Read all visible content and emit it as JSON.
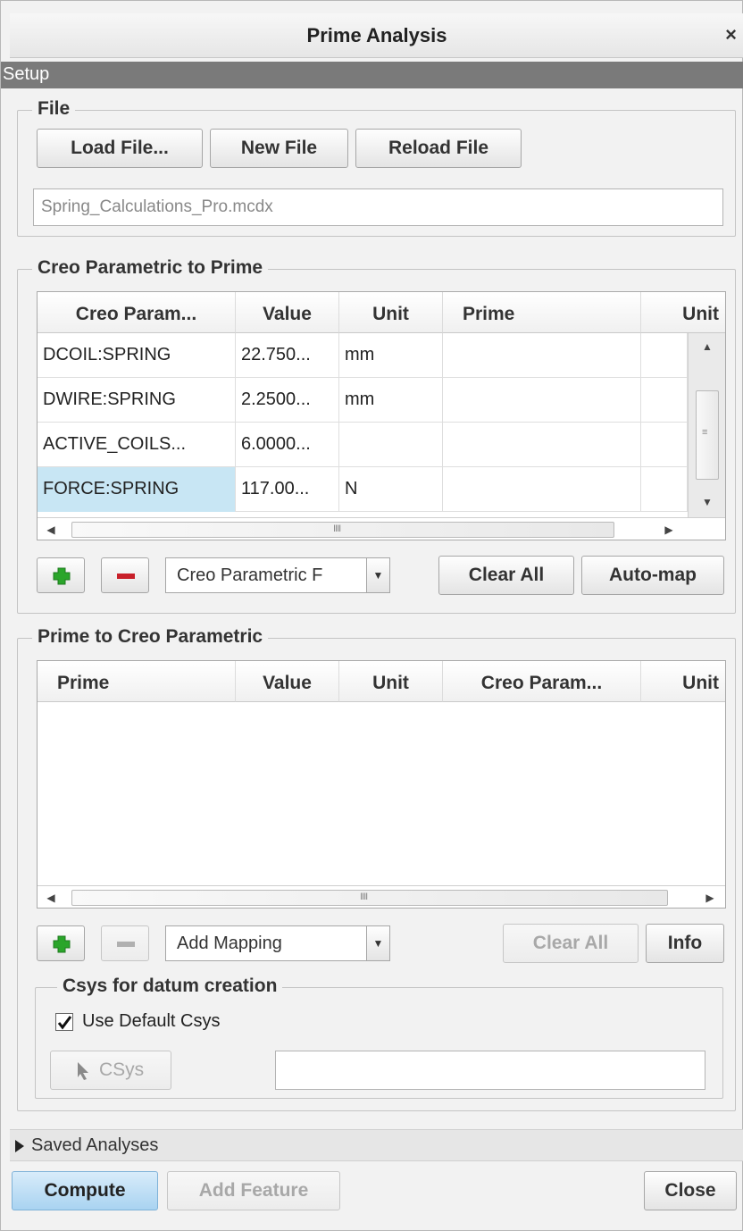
{
  "window": {
    "title": "Prime Analysis",
    "close_glyph": "×"
  },
  "setup": {
    "label": "Setup"
  },
  "file_group": {
    "title": "File",
    "load_label": "Load File...",
    "new_label": "New File",
    "reload_label": "Reload File",
    "filename": "Spring_Calculations_Pro.mcdx"
  },
  "to_prime": {
    "title": "Creo Parametric to Prime",
    "columns": [
      "Creo Param...",
      "Value",
      "Unit",
      "Prime",
      "Unit"
    ],
    "rows": [
      {
        "param": "DCOIL:SPRING",
        "value": "22.750...",
        "unit": "mm",
        "prime": "",
        "prime_unit": ""
      },
      {
        "param": "DWIRE:SPRING",
        "value": "2.2500...",
        "unit": "mm",
        "prime": "",
        "prime_unit": ""
      },
      {
        "param": "ACTIVE_COILS...",
        "value": "6.0000...",
        "unit": "",
        "prime": "",
        "prime_unit": ""
      },
      {
        "param": "FORCE:SPRING",
        "value": "117.00...",
        "unit": "N",
        "prime": "",
        "prime_unit": ""
      }
    ],
    "combo_value": "Creo Parametric F",
    "clear_all_label": "Clear All",
    "automap_label": "Auto-map"
  },
  "from_prime": {
    "title": "Prime to Creo Parametric",
    "columns": [
      "Prime",
      "Value",
      "Unit",
      "Creo Param...",
      "Unit"
    ],
    "combo_value": "Add Mapping",
    "clear_all_label": "Clear All",
    "info_label": "Info"
  },
  "csys": {
    "title": "Csys for datum creation",
    "use_default_label": "Use Default Csys",
    "use_default_checked": true,
    "csys_button_label": "CSys",
    "csys_value": ""
  },
  "saved_analyses": {
    "label": "Saved Analyses"
  },
  "footer": {
    "compute_label": "Compute",
    "add_feature_label": "Add Feature",
    "close_label": "Close"
  },
  "colors": {
    "plus_icon": "#2aa52a",
    "minus_icon": "#c8202a",
    "selected_cell": "#c8e6f4",
    "compute_button": "#a9d3f1"
  }
}
